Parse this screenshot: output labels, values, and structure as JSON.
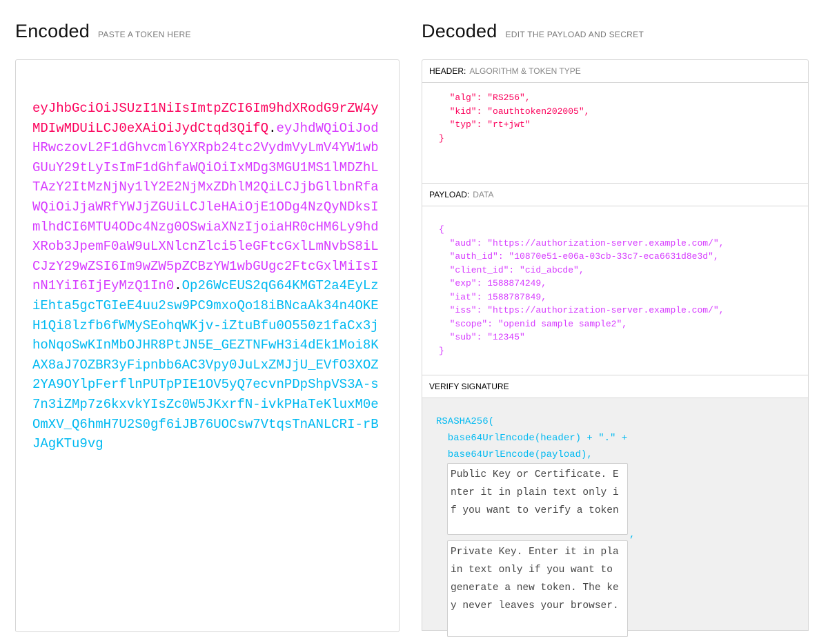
{
  "encoded": {
    "title": "Encoded",
    "subtitle": "PASTE A TOKEN HERE",
    "token": {
      "header": "eyJhbGciOiJSUzI1NiIsImtpZCI6Im9hdXRodG9rZW4yMDIwMDUiLCJ0eXAiOiJydCtqd3QifQ",
      "dot1": ".",
      "payload": "eyJhdWQiOiJodHRwczovL2F1dGhvcml6YXRpb24tc2VydmVyLmV4YW1wbGUuY29tLyIsImF1dGhfaWQiOiIxMDg3MGU1MS1lMDZhLTAzY2ItMzNjNy1lY2E2NjMxZDhlM2QiLCJjbGllbnRfaWQiOiJjaWRfYWJjZGUiLCJleHAiOjE1ODg4NzQyNDksImlhdCI6MTU4ODc4Nzg0OSwiaXNzIjoiaHR0cHM6Ly9hdXRob3JpemF0aW9uLXNlcnZlci5leGFtcGxlLmNvbS8iLCJzY29wZSI6Im9wZW5pZCBzYW1wbGUgc2FtcGxlMiIsInN1YiI6IjEyMzQ1In0",
      "dot2": ".",
      "signature": "Op26WcEUS2qG64KMGT2a4EyLziEhta5gcTGIeE4uu2sw9PC9mxoQo18iBNcaAk34n4OKEH1Qi8lzfb6fWMySEohqWKjv-iZtuBfu0O550z1faCx3jhoNqoSwKInMbOJHR8PtJN5E_GEZTNFwH3i4dEk1Moi8KAX8aJ7OZBR3yFipnbb6AC3Vpy0JuLxZMJjU_EVfO3XOZ2YA9OYlpFerflnPUTpPIE1OV5yQ7ecvnPDpShpVS3A-s7n3iZMp7z6kxvkYIsZc0W5JKxrfN-ivkPHaTeKluxM0eOmXV_Q6hmH7U2S0gf6iJB76UOCsw7VtqsTnANLCRI-rBJAgKTu9vg"
    }
  },
  "decoded": {
    "title": "Decoded",
    "subtitle": "EDIT THE PAYLOAD AND SECRET",
    "header_panel": {
      "label": "HEADER:",
      "hint": "ALGORITHM & TOKEN TYPE",
      "json": "  \"alg\": \"RS256\",\n  \"kid\": \"oauthtoken202005\",\n  \"typ\": \"rt+jwt\"\n}"
    },
    "payload_panel": {
      "label": "PAYLOAD:",
      "hint": "DATA",
      "json": "{\n  \"aud\": \"https://authorization-server.example.com/\",\n  \"auth_id\": \"10870e51-e06a-03cb-33c7-eca6631d8e3d\",\n  \"client_id\": \"cid_abcde\",\n  \"exp\": 1588874249,\n  \"iat\": 1588787849,\n  \"iss\": \"https://authorization-server.example.com/\",\n  \"scope\": \"openid sample sample2\",\n  \"sub\": \"12345\"\n}"
    },
    "signature_panel": {
      "label": "VERIFY SIGNATURE",
      "line1": "RSASHA256(",
      "line2": "  base64UrlEncode(header) + \".\" +",
      "line3": "  base64UrlEncode(payload),",
      "public_key_placeholder": "Public Key or Certificate. Enter it in plain text only if you want to verify a token",
      "comma": ",",
      "private_key_placeholder": "Private Key. Enter it in plain text only if you want to generate a new token. The key never leaves your browser."
    }
  },
  "colors": {
    "header": "#fb015b",
    "payload": "#d63aff",
    "signature": "#00b9f1"
  }
}
